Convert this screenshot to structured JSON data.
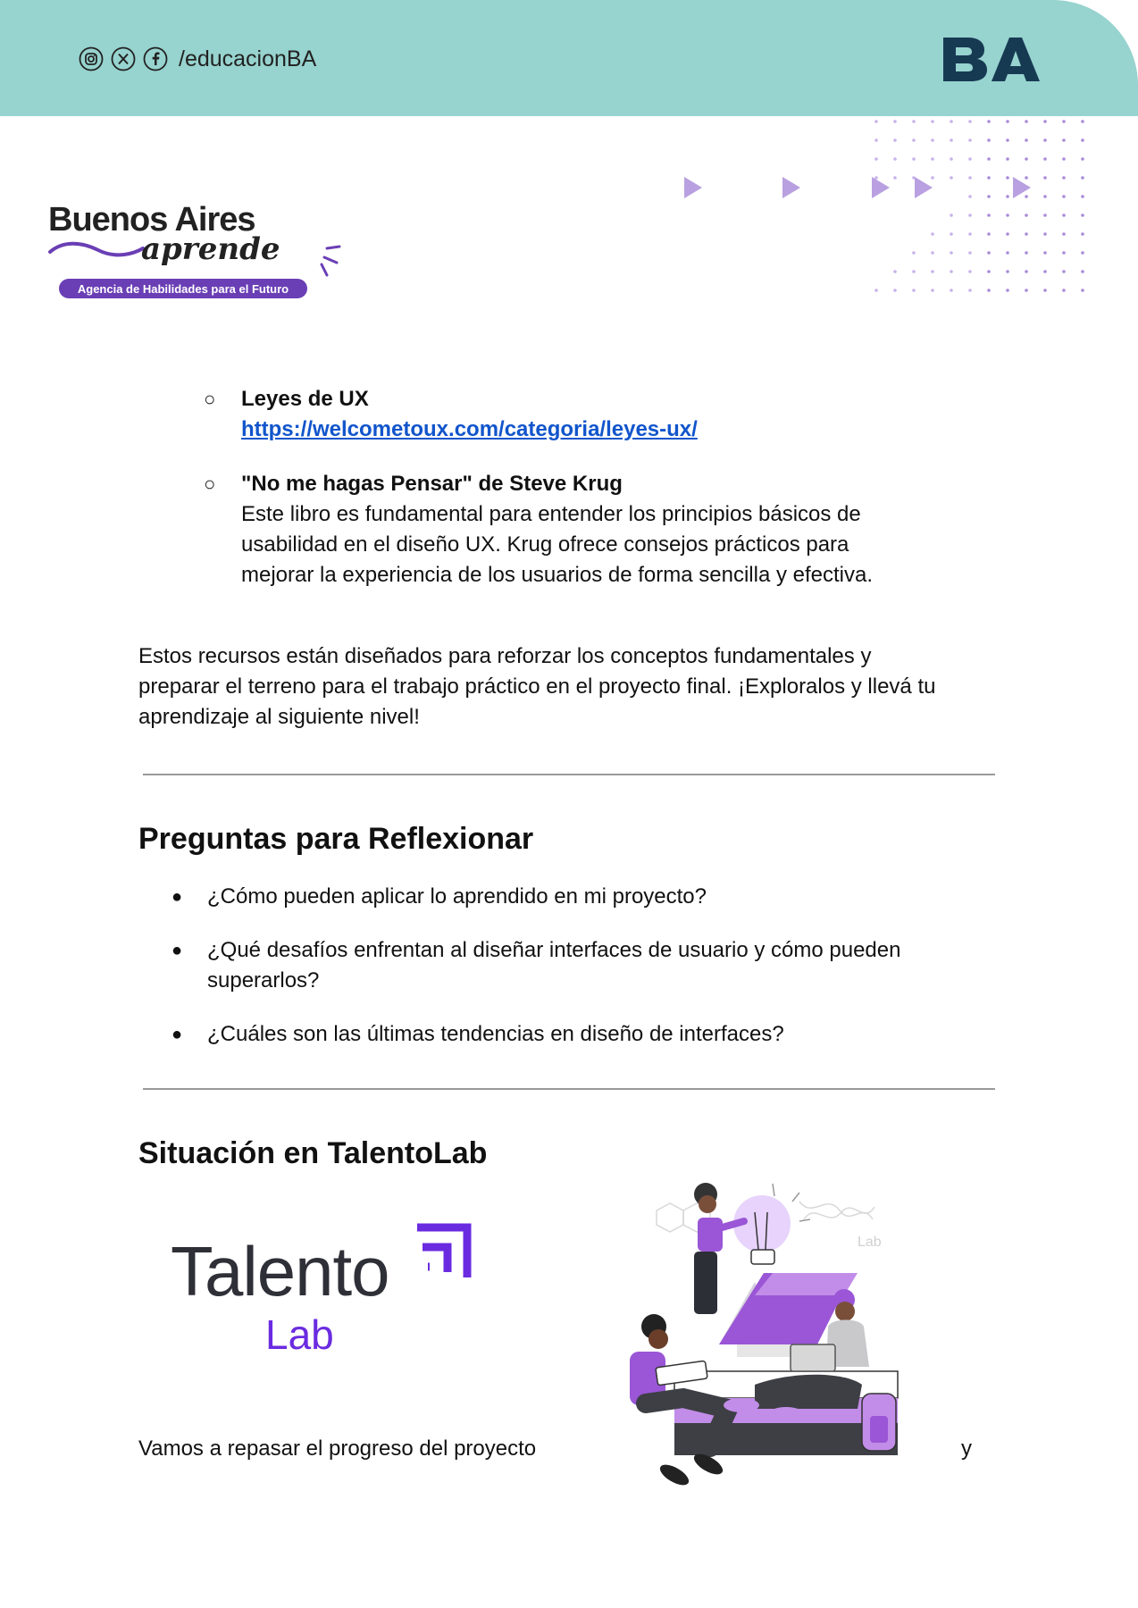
{
  "header": {
    "social_handle": "/educacionBA",
    "social_icons": [
      "instagram-icon",
      "x-icon",
      "facebook-icon"
    ],
    "brand_logo_text": "BA",
    "band_color": "#97d3cf"
  },
  "branding": {
    "logo_line1": "Buenos Aires",
    "logo_line2": "aprende",
    "logo_tagline": "Agencia de Habilidades para el Futuro",
    "accent_color": "#6a3fb5"
  },
  "resources": [
    {
      "title": "Leyes de UX",
      "link": "https://welcometoux.com/categoria/leyes-ux/"
    },
    {
      "title": "\"No me hagas Pensar\" de Steve Krug",
      "desc_lines": [
        "Este libro es fundamental para entender los principios básicos de",
        "usabilidad en el diseño UX. Krug ofrece consejos prácticos para",
        "mejorar la experiencia de los usuarios de forma sencilla y efectiva."
      ]
    }
  ],
  "summary_lines": [
    "Estos recursos están diseñados para reforzar los conceptos fundamentales y",
    "preparar el terreno para el trabajo práctico en el proyecto final. ¡Exploralos y llevá tu",
    "aprendizaje al siguiente nivel!"
  ],
  "reflection": {
    "heading": "Preguntas para Reflexionar",
    "questions": [
      {
        "lines": [
          "¿Cómo pueden aplicar lo aprendido en mi proyecto?"
        ]
      },
      {
        "lines": [
          "¿Qué desafíos enfrentan al diseñar interfaces de usuario y cómo pueden",
          "superarlos?"
        ]
      },
      {
        "lines": [
          "¿Cuáles son las últimas tendencias en diseño de interfaces?"
        ]
      }
    ]
  },
  "situation": {
    "heading": "Situación en TalentoLab",
    "logo_word": "Talento",
    "logo_sub": "Lab",
    "illustration_sign": "Lab",
    "text_left": "Vamos a repasar el progreso del proyecto",
    "text_right": "y"
  }
}
